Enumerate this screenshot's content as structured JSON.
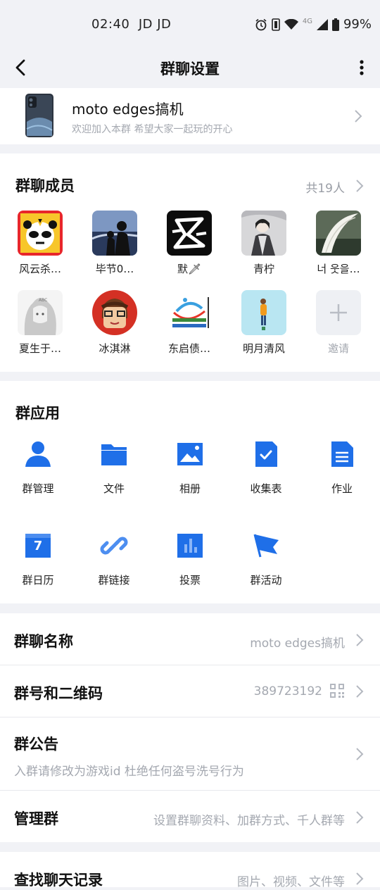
{
  "status_bar": {
    "time": "02:40",
    "carrier": "JD JD",
    "network": "4G",
    "battery": "99%"
  },
  "nav": {
    "title": "群聊设置"
  },
  "group": {
    "name": "moto edges搞机",
    "description": "欢迎加入本群 希望大家一起玩的开心"
  },
  "members": {
    "title": "群聊成员",
    "count": "共19人",
    "items": [
      {
        "name": "风云杀…"
      },
      {
        "name": "毕节0…"
      },
      {
        "name": "默🗡"
      },
      {
        "name": "青柠"
      },
      {
        "name": "너 웃을…"
      },
      {
        "name": "夏生于…"
      },
      {
        "name": "冰淇淋"
      },
      {
        "name": "东启债…"
      },
      {
        "name": "明月清风"
      },
      {
        "name": "邀请"
      }
    ]
  },
  "apps": {
    "title": "群应用",
    "items": [
      {
        "label": "群管理",
        "icon": "person-icon"
      },
      {
        "label": "文件",
        "icon": "folder-icon"
      },
      {
        "label": "相册",
        "icon": "photo-icon"
      },
      {
        "label": "收集表",
        "icon": "form-check-icon"
      },
      {
        "label": "作业",
        "icon": "document-icon"
      },
      {
        "label": "群日历",
        "icon": "calendar-icon",
        "day": "7"
      },
      {
        "label": "群链接",
        "icon": "link-icon"
      },
      {
        "label": "投票",
        "icon": "poll-icon"
      },
      {
        "label": "群活动",
        "icon": "flag-icon"
      }
    ]
  },
  "settings": {
    "group_name": {
      "label": "群聊名称",
      "value": "moto edges搞机"
    },
    "group_number": {
      "label": "群号和二维码",
      "value": "389723192"
    },
    "announcement": {
      "label": "群公告",
      "value": "入群请修改为游戏id 杜绝任何盗号洗号行为"
    },
    "manage": {
      "label": "管理群",
      "value": "设置群聊资料、加群方式、千人群等"
    },
    "search_history": {
      "label": "查找聊天记录",
      "value": "图片、视频、文件等"
    }
  },
  "colors": {
    "accent": "#1f6fe8",
    "background": "#f1f2f6",
    "secondary_text": "#a4a8b0"
  }
}
